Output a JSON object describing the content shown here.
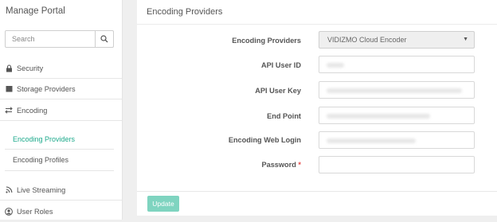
{
  "sidebar": {
    "title": "Manage Portal",
    "search": {
      "placeholder": "Search"
    },
    "items": [
      {
        "label": "Security",
        "icon": "lock-icon"
      },
      {
        "label": "Storage Providers",
        "icon": "storage-icon"
      },
      {
        "label": "Encoding",
        "icon": "swap-arrows-icon"
      },
      {
        "label": "Live Streaming",
        "icon": "wifi-signal-icon"
      },
      {
        "label": "User Roles",
        "icon": "user-icon"
      }
    ],
    "encoding_sub": [
      {
        "label": "Encoding Providers",
        "active": true
      },
      {
        "label": "Encoding Profiles",
        "active": false
      }
    ]
  },
  "main": {
    "title": "Encoding Providers",
    "form": {
      "provider_label": "Encoding Providers",
      "provider_value": "VIDIZMO Cloud Encoder",
      "api_user_id_label": "API User ID",
      "api_user_key_label": "API User Key",
      "end_point_label": "End Point",
      "web_login_label": "Encoding Web Login",
      "password_label": "Password",
      "required_mark": "*"
    },
    "update_label": "Update"
  },
  "colors": {
    "accent": "#1eaa8c",
    "button": "#7fd4c0",
    "required": "#e64b4b"
  }
}
